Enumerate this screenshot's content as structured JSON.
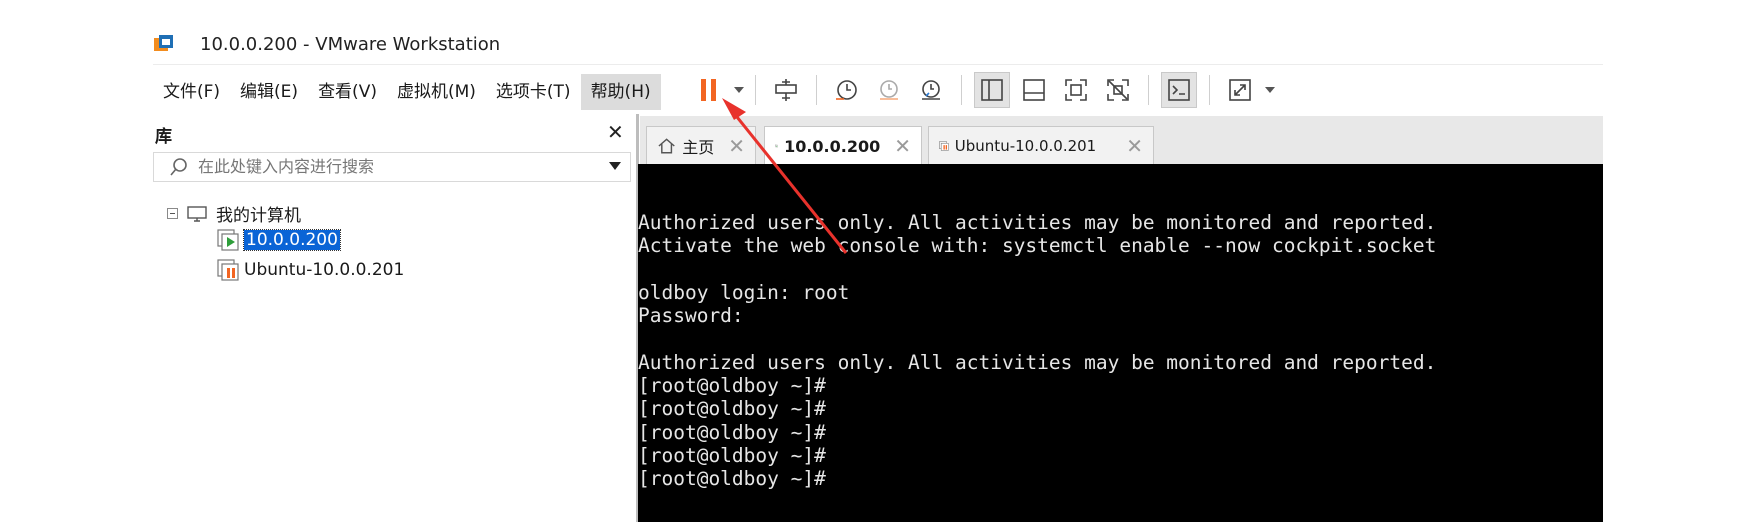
{
  "window": {
    "title": "10.0.0.200 - VMware Workstation"
  },
  "menu": [
    "文件(F)",
    "编辑(E)",
    "查看(V)",
    "虚拟机(M)",
    "选项卡(T)",
    "帮助(H)"
  ],
  "toolbar": {
    "icons": [
      "pause-icon",
      "chevron-down-icon",
      "send-ctrl-alt-del-icon",
      "snapshot-take-icon",
      "snapshot-revert-icon",
      "snapshot-manager-icon",
      "library-view-icon",
      "thumbnail-bar-icon",
      "full-screen-icon",
      "unity-icon",
      "console-view-icon",
      "stretch-icon",
      "chevron-down-icon"
    ],
    "accent_color": "#f26522"
  },
  "library": {
    "title": "库",
    "search_placeholder": "在此处键入内容进行搜索",
    "root": "我的计算机",
    "items": [
      {
        "label": "10.0.0.200",
        "selected": true,
        "state": "running"
      },
      {
        "label": "Ubuntu-10.0.0.201",
        "selected": false,
        "state": "paused"
      }
    ]
  },
  "tabs": [
    {
      "label": "主页",
      "active": false
    },
    {
      "label": "10.0.0.200",
      "active": true
    },
    {
      "label": "Ubuntu-10.0.0.201",
      "active": false
    }
  ],
  "console": {
    "lines": [
      "Authorized users only. All activities may be monitored and reported.",
      "Activate the web console with: systemctl enable --now cockpit.socket",
      "",
      "oldboy login: root",
      "Password:",
      "",
      "Authorized users only. All activities may be monitored and reported.",
      "[root@oldboy ~]#",
      "[root@oldboy ~]#",
      "[root@oldboy ~]#",
      "[root@oldboy ~]#",
      "[root@oldboy ~]#"
    ]
  },
  "annotation": {
    "color": "#e8322c"
  }
}
